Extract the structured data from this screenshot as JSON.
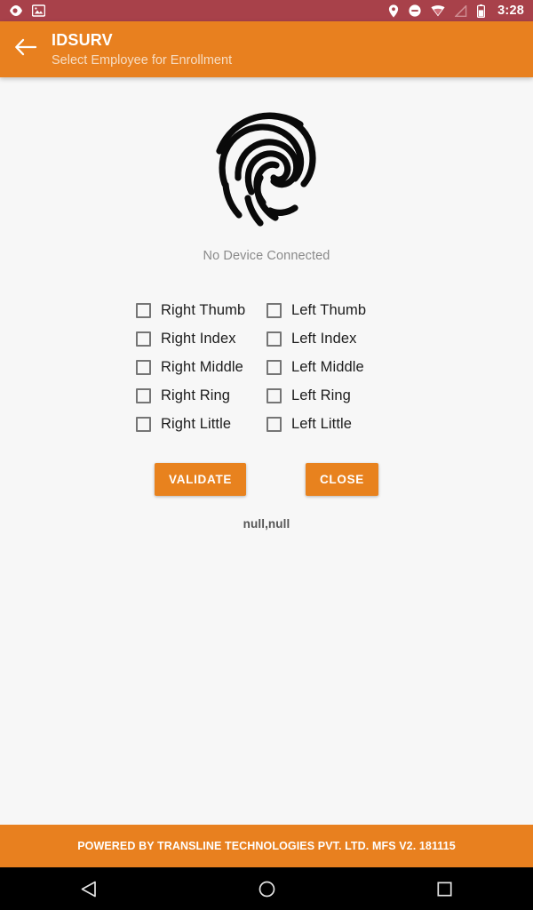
{
  "status_bar": {
    "clock": "3:28",
    "background": "#a8414a",
    "left_icons": [
      {
        "name": "tag-eye-icon"
      },
      {
        "name": "image-notification-icon"
      }
    ],
    "right_icons": [
      {
        "name": "location-pin-icon"
      },
      {
        "name": "do-not-disturb-icon"
      },
      {
        "name": "wifi-icon"
      },
      {
        "name": "signal-off-icon"
      },
      {
        "name": "battery-icon"
      }
    ]
  },
  "app_bar": {
    "back_icon": "arrow-back-icon",
    "title": "IDSURV",
    "subtitle": "Select Employee for Enrollment",
    "background": "#e8801f"
  },
  "main": {
    "fingerprint_icon": "fingerprint-icon",
    "device_status": "No Device Connected",
    "fingers": [
      {
        "label": "Right Thumb",
        "checked": false
      },
      {
        "label": "Left Thumb",
        "checked": false
      },
      {
        "label": "Right Index",
        "checked": false
      },
      {
        "label": "Left Index",
        "checked": false
      },
      {
        "label": "Right Middle",
        "checked": false
      },
      {
        "label": "Left Middle",
        "checked": false
      },
      {
        "label": "Right Ring",
        "checked": false
      },
      {
        "label": "Left Ring",
        "checked": false
      },
      {
        "label": "Right Little",
        "checked": false
      },
      {
        "label": "Left Little",
        "checked": false
      }
    ],
    "validate_label": "VALIDATE",
    "close_label": "CLOSE",
    "result_text": "null,null",
    "button_color": "#e8821e"
  },
  "footer": {
    "text": "POWERED BY TRANSLINE TECHNOLOGIES PVT. LTD. MFS V2. 181115",
    "background": "#e8801f"
  },
  "nav_bar": {
    "back_icon": "nav-back-triangle-icon",
    "home_icon": "nav-home-circle-icon",
    "recents_icon": "nav-recents-square-icon"
  }
}
